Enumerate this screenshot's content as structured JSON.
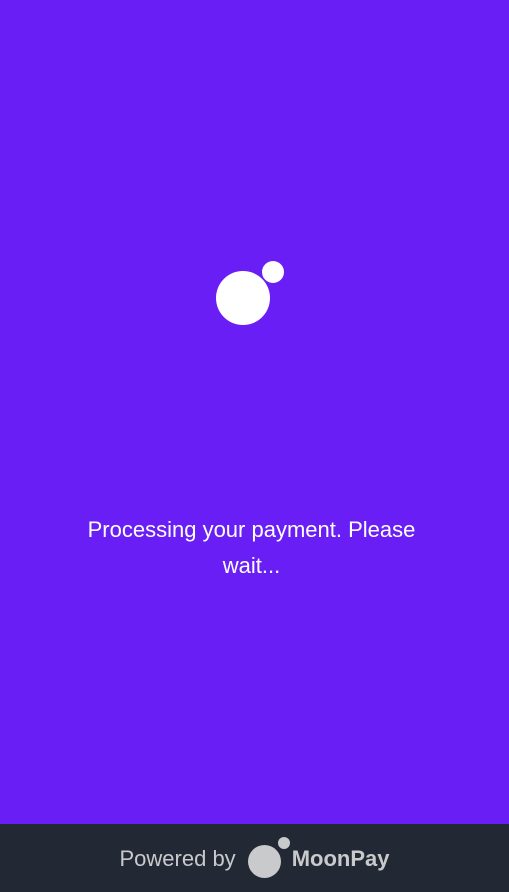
{
  "colors": {
    "background": "#6a1ef6",
    "footer_background": "#222834",
    "text": "#ffffff",
    "footer_text": "#c9cacc"
  },
  "loader": {
    "icon": "moonpay-logo-icon"
  },
  "status": {
    "message": "Processing your payment. Please wait..."
  },
  "footer": {
    "powered_by": "Powered by",
    "brand_name": "MoonPay",
    "brand_icon": "moonpay-logo-icon"
  }
}
